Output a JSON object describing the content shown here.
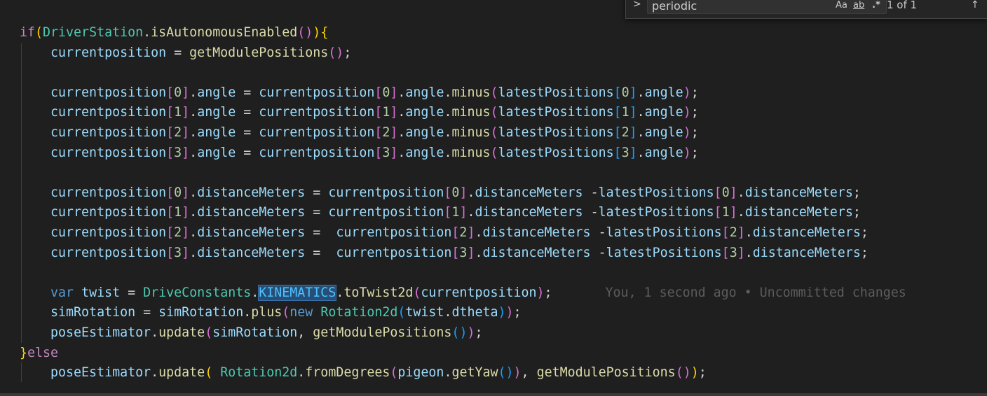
{
  "find_widget": {
    "toggle_glyph": ">",
    "query": "periodic",
    "match_case_label": "Aa",
    "whole_word_label": "ab",
    "regex_label": ".*",
    "result_count": "1 of 1",
    "prev_glyph": "↑"
  },
  "blame": {
    "text": "You, 1 second ago • Uncommitted changes"
  },
  "code_lines": [
    [
      [
        "if",
        "control"
      ],
      [
        "(",
        "b1"
      ],
      [
        "DriverStation",
        "class"
      ],
      [
        ".",
        "punc"
      ],
      [
        "isAutonomousEnabled",
        "method"
      ],
      [
        "(",
        "b2"
      ],
      [
        ")",
        "b2"
      ],
      [
        ")",
        "b1"
      ],
      [
        "{",
        "b1"
      ]
    ],
    [
      [
        "    ",
        "punc"
      ],
      [
        "currentposition",
        "var"
      ],
      [
        " = ",
        "punc"
      ],
      [
        "getModulePositions",
        "method"
      ],
      [
        "(",
        "b2"
      ],
      [
        ")",
        "b2"
      ],
      [
        ";",
        "punc"
      ]
    ],
    [],
    [
      [
        "    ",
        "punc"
      ],
      [
        "currentposition",
        "var"
      ],
      [
        "[",
        "b2"
      ],
      [
        "0",
        "num"
      ],
      [
        "]",
        "b2"
      ],
      [
        ".",
        "punc"
      ],
      [
        "angle",
        "var"
      ],
      [
        " = ",
        "punc"
      ],
      [
        "currentposition",
        "var"
      ],
      [
        "[",
        "b2"
      ],
      [
        "0",
        "num"
      ],
      [
        "]",
        "b2"
      ],
      [
        ".",
        "punc"
      ],
      [
        "angle",
        "var"
      ],
      [
        ".",
        "punc"
      ],
      [
        "minus",
        "method"
      ],
      [
        "(",
        "b2"
      ],
      [
        "latestPositions",
        "var"
      ],
      [
        "[",
        "b3"
      ],
      [
        "0",
        "num"
      ],
      [
        "]",
        "b3"
      ],
      [
        ".",
        "punc"
      ],
      [
        "angle",
        "var"
      ],
      [
        ")",
        "b2"
      ],
      [
        ";",
        "punc"
      ]
    ],
    [
      [
        "    ",
        "punc"
      ],
      [
        "currentposition",
        "var"
      ],
      [
        "[",
        "b2"
      ],
      [
        "1",
        "num"
      ],
      [
        "]",
        "b2"
      ],
      [
        ".",
        "punc"
      ],
      [
        "angle",
        "var"
      ],
      [
        " = ",
        "punc"
      ],
      [
        "currentposition",
        "var"
      ],
      [
        "[",
        "b2"
      ],
      [
        "1",
        "num"
      ],
      [
        "]",
        "b2"
      ],
      [
        ".",
        "punc"
      ],
      [
        "angle",
        "var"
      ],
      [
        ".",
        "punc"
      ],
      [
        "minus",
        "method"
      ],
      [
        "(",
        "b2"
      ],
      [
        "latestPositions",
        "var"
      ],
      [
        "[",
        "b3"
      ],
      [
        "1",
        "num"
      ],
      [
        "]",
        "b3"
      ],
      [
        ".",
        "punc"
      ],
      [
        "angle",
        "var"
      ],
      [
        ")",
        "b2"
      ],
      [
        ";",
        "punc"
      ]
    ],
    [
      [
        "    ",
        "punc"
      ],
      [
        "currentposition",
        "var"
      ],
      [
        "[",
        "b2"
      ],
      [
        "2",
        "num"
      ],
      [
        "]",
        "b2"
      ],
      [
        ".",
        "punc"
      ],
      [
        "angle",
        "var"
      ],
      [
        " = ",
        "punc"
      ],
      [
        "currentposition",
        "var"
      ],
      [
        "[",
        "b2"
      ],
      [
        "2",
        "num"
      ],
      [
        "]",
        "b2"
      ],
      [
        ".",
        "punc"
      ],
      [
        "angle",
        "var"
      ],
      [
        ".",
        "punc"
      ],
      [
        "minus",
        "method"
      ],
      [
        "(",
        "b2"
      ],
      [
        "latestPositions",
        "var"
      ],
      [
        "[",
        "b3"
      ],
      [
        "2",
        "num"
      ],
      [
        "]",
        "b3"
      ],
      [
        ".",
        "punc"
      ],
      [
        "angle",
        "var"
      ],
      [
        ")",
        "b2"
      ],
      [
        ";",
        "punc"
      ]
    ],
    [
      [
        "    ",
        "punc"
      ],
      [
        "currentposition",
        "var"
      ],
      [
        "[",
        "b2"
      ],
      [
        "3",
        "num"
      ],
      [
        "]",
        "b2"
      ],
      [
        ".",
        "punc"
      ],
      [
        "angle",
        "var"
      ],
      [
        " = ",
        "punc"
      ],
      [
        "currentposition",
        "var"
      ],
      [
        "[",
        "b2"
      ],
      [
        "3",
        "num"
      ],
      [
        "]",
        "b2"
      ],
      [
        ".",
        "punc"
      ],
      [
        "angle",
        "var"
      ],
      [
        ".",
        "punc"
      ],
      [
        "minus",
        "method"
      ],
      [
        "(",
        "b2"
      ],
      [
        "latestPositions",
        "var"
      ],
      [
        "[",
        "b3"
      ],
      [
        "3",
        "num"
      ],
      [
        "]",
        "b3"
      ],
      [
        ".",
        "punc"
      ],
      [
        "angle",
        "var"
      ],
      [
        ")",
        "b2"
      ],
      [
        ";",
        "punc"
      ]
    ],
    [],
    [
      [
        "    ",
        "punc"
      ],
      [
        "currentposition",
        "var"
      ],
      [
        "[",
        "b2"
      ],
      [
        "0",
        "num"
      ],
      [
        "]",
        "b2"
      ],
      [
        ".",
        "punc"
      ],
      [
        "distanceMeters",
        "var"
      ],
      [
        " = ",
        "punc"
      ],
      [
        "currentposition",
        "var"
      ],
      [
        "[",
        "b2"
      ],
      [
        "0",
        "num"
      ],
      [
        "]",
        "b2"
      ],
      [
        ".",
        "punc"
      ],
      [
        "distanceMeters",
        "var"
      ],
      [
        " -",
        "punc"
      ],
      [
        "latestPositions",
        "var"
      ],
      [
        "[",
        "b2"
      ],
      [
        "0",
        "num"
      ],
      [
        "]",
        "b2"
      ],
      [
        ".",
        "punc"
      ],
      [
        "distanceMeters",
        "var"
      ],
      [
        ";",
        "punc"
      ]
    ],
    [
      [
        "    ",
        "punc"
      ],
      [
        "currentposition",
        "var"
      ],
      [
        "[",
        "b2"
      ],
      [
        "1",
        "num"
      ],
      [
        "]",
        "b2"
      ],
      [
        ".",
        "punc"
      ],
      [
        "distanceMeters",
        "var"
      ],
      [
        " = ",
        "punc"
      ],
      [
        "currentposition",
        "var"
      ],
      [
        "[",
        "b2"
      ],
      [
        "1",
        "num"
      ],
      [
        "]",
        "b2"
      ],
      [
        ".",
        "punc"
      ],
      [
        "distanceMeters",
        "var"
      ],
      [
        " -",
        "punc"
      ],
      [
        "latestPositions",
        "var"
      ],
      [
        "[",
        "b2"
      ],
      [
        "1",
        "num"
      ],
      [
        "]",
        "b2"
      ],
      [
        ".",
        "punc"
      ],
      [
        "distanceMeters",
        "var"
      ],
      [
        ";",
        "punc"
      ]
    ],
    [
      [
        "    ",
        "punc"
      ],
      [
        "currentposition",
        "var"
      ],
      [
        "[",
        "b2"
      ],
      [
        "2",
        "num"
      ],
      [
        "]",
        "b2"
      ],
      [
        ".",
        "punc"
      ],
      [
        "distanceMeters",
        "var"
      ],
      [
        " =  ",
        "punc"
      ],
      [
        "currentposition",
        "var"
      ],
      [
        "[",
        "b2"
      ],
      [
        "2",
        "num"
      ],
      [
        "]",
        "b2"
      ],
      [
        ".",
        "punc"
      ],
      [
        "distanceMeters",
        "var"
      ],
      [
        " -",
        "punc"
      ],
      [
        "latestPositions",
        "var"
      ],
      [
        "[",
        "b2"
      ],
      [
        "2",
        "num"
      ],
      [
        "]",
        "b2"
      ],
      [
        ".",
        "punc"
      ],
      [
        "distanceMeters",
        "var"
      ],
      [
        ";",
        "punc"
      ]
    ],
    [
      [
        "    ",
        "punc"
      ],
      [
        "currentposition",
        "var"
      ],
      [
        "[",
        "b2"
      ],
      [
        "3",
        "num"
      ],
      [
        "]",
        "b2"
      ],
      [
        ".",
        "punc"
      ],
      [
        "distanceMeters",
        "var"
      ],
      [
        " =  ",
        "punc"
      ],
      [
        "currentposition",
        "var"
      ],
      [
        "[",
        "b2"
      ],
      [
        "3",
        "num"
      ],
      [
        "]",
        "b2"
      ],
      [
        ".",
        "punc"
      ],
      [
        "distanceMeters",
        "var"
      ],
      [
        " -",
        "punc"
      ],
      [
        "latestPositions",
        "var"
      ],
      [
        "[",
        "b2"
      ],
      [
        "3",
        "num"
      ],
      [
        "]",
        "b2"
      ],
      [
        ".",
        "punc"
      ],
      [
        "distanceMeters",
        "var"
      ],
      [
        ";",
        "punc"
      ]
    ],
    [],
    [
      [
        "    ",
        "punc"
      ],
      [
        "var",
        "keyword"
      ],
      [
        " ",
        "punc"
      ],
      [
        "twist",
        "var"
      ],
      [
        " = ",
        "punc"
      ],
      [
        "DriveConstants",
        "class"
      ],
      [
        ".",
        "punc"
      ],
      [
        "KINEMATICS",
        "const_hl"
      ],
      [
        ".",
        "punc"
      ],
      [
        "toTwist2d",
        "method"
      ],
      [
        "(",
        "b2"
      ],
      [
        "currentposition",
        "var"
      ],
      [
        ")",
        "b2"
      ],
      [
        ";",
        "punc"
      ]
    ],
    [
      [
        "    ",
        "punc"
      ],
      [
        "simRotation",
        "var"
      ],
      [
        " = ",
        "punc"
      ],
      [
        "simRotation",
        "var"
      ],
      [
        ".",
        "punc"
      ],
      [
        "plus",
        "method"
      ],
      [
        "(",
        "b2"
      ],
      [
        "new",
        "keyword"
      ],
      [
        " ",
        "punc"
      ],
      [
        "Rotation2d",
        "class"
      ],
      [
        "(",
        "b3"
      ],
      [
        "twist",
        "var"
      ],
      [
        ".",
        "punc"
      ],
      [
        "dtheta",
        "var"
      ],
      [
        ")",
        "b3"
      ],
      [
        ")",
        "b2"
      ],
      [
        ";",
        "punc"
      ]
    ],
    [
      [
        "    ",
        "punc"
      ],
      [
        "poseEstimator",
        "var"
      ],
      [
        ".",
        "punc"
      ],
      [
        "update",
        "method"
      ],
      [
        "(",
        "b2"
      ],
      [
        "simRotation",
        "var"
      ],
      [
        ", ",
        "punc"
      ],
      [
        "getModulePositions",
        "method"
      ],
      [
        "(",
        "b3"
      ],
      [
        ")",
        "b3"
      ],
      [
        ")",
        "b2"
      ],
      [
        ";",
        "punc"
      ]
    ],
    [
      [
        "}",
        "b1"
      ],
      [
        "else",
        "control"
      ]
    ],
    [
      [
        "    ",
        "punc"
      ],
      [
        "poseEstimator",
        "var"
      ],
      [
        ".",
        "punc"
      ],
      [
        "update",
        "method"
      ],
      [
        "(",
        "b1"
      ],
      [
        " ",
        "punc"
      ],
      [
        "Rotation2d",
        "class"
      ],
      [
        ".",
        "punc"
      ],
      [
        "fromDegrees",
        "method"
      ],
      [
        "(",
        "b2"
      ],
      [
        "pigeon",
        "var"
      ],
      [
        ".",
        "punc"
      ],
      [
        "getYaw",
        "method"
      ],
      [
        "(",
        "b3"
      ],
      [
        ")",
        "b3"
      ],
      [
        ")",
        "b2"
      ],
      [
        ", ",
        "punc"
      ],
      [
        "getModulePositions",
        "method"
      ],
      [
        "(",
        "b2"
      ],
      [
        ")",
        "b2"
      ],
      [
        ")",
        "b1"
      ],
      [
        ";",
        "punc"
      ]
    ]
  ]
}
